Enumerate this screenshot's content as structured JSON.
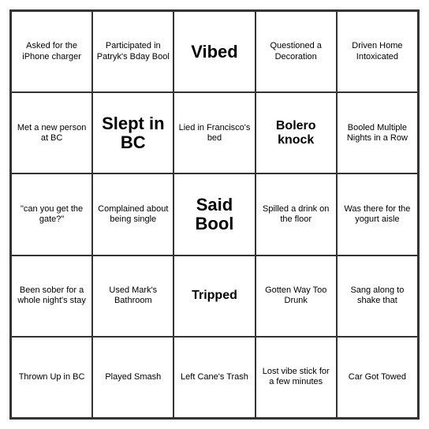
{
  "board": {
    "cells": [
      {
        "text": "Asked for the iPhone charger",
        "size": "small"
      },
      {
        "text": "Participated in Patryk's Bday Bool",
        "size": "small"
      },
      {
        "text": "Vibed",
        "size": "large"
      },
      {
        "text": "Questioned a Decoration",
        "size": "small"
      },
      {
        "text": "Driven Home Intoxicated",
        "size": "small"
      },
      {
        "text": "Met a new person at BC",
        "size": "small"
      },
      {
        "text": "Slept in BC",
        "size": "large"
      },
      {
        "text": "Lied in Francisco's bed",
        "size": "small"
      },
      {
        "text": "Bolero knock",
        "size": "medium"
      },
      {
        "text": "Booled Multiple Nights in a Row",
        "size": "small"
      },
      {
        "text": "\"can you get the gate?\"",
        "size": "small"
      },
      {
        "text": "Complained about being single",
        "size": "small"
      },
      {
        "text": "Said Bool",
        "size": "large"
      },
      {
        "text": "Spilled a drink on the floor",
        "size": "small"
      },
      {
        "text": "Was there for the yogurt aisle",
        "size": "small"
      },
      {
        "text": "Been sober for a whole night's stay",
        "size": "small"
      },
      {
        "text": "Used Mark's Bathroom",
        "size": "small"
      },
      {
        "text": "Tripped",
        "size": "medium"
      },
      {
        "text": "Gotten Way Too Drunk",
        "size": "small"
      },
      {
        "text": "Sang along to shake that",
        "size": "small"
      },
      {
        "text": "Thrown Up in BC",
        "size": "small"
      },
      {
        "text": "Played Smash",
        "size": "small"
      },
      {
        "text": "Left Cane's Trash",
        "size": "small"
      },
      {
        "text": "Lost vibe stick for a few minutes",
        "size": "small"
      },
      {
        "text": "Car Got Towed",
        "size": "small"
      }
    ]
  }
}
